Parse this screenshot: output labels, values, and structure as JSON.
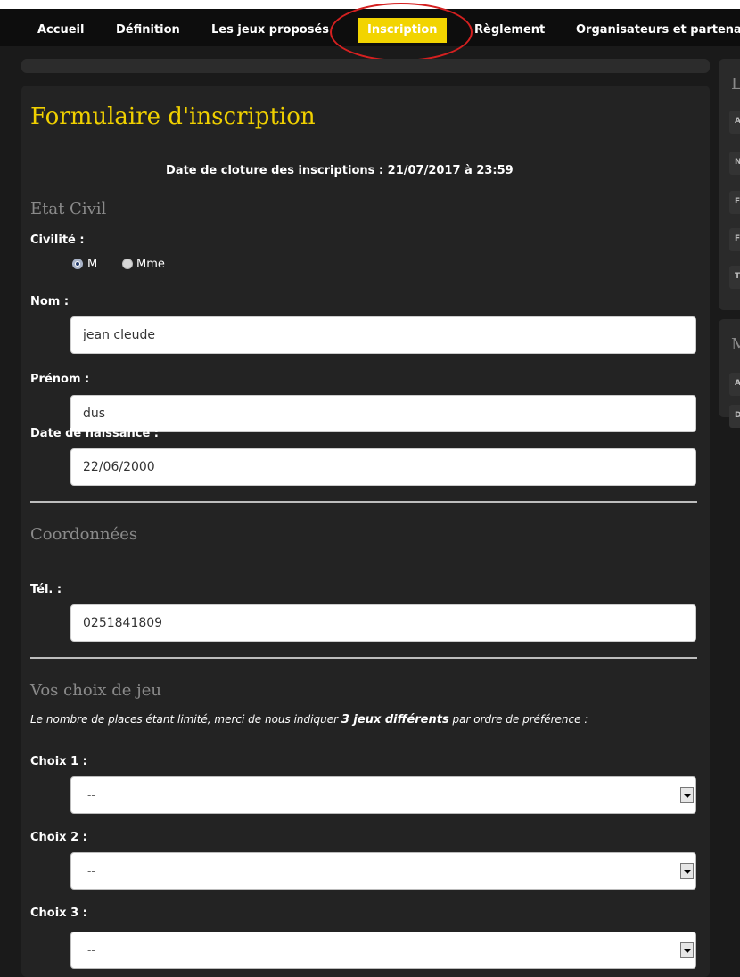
{
  "nav": {
    "items": [
      "Accueil",
      "Définition",
      "Les jeux proposés",
      "Inscription",
      "Règlement",
      "Organisateurs et partenaires"
    ],
    "active": "Inscription",
    "accent": "#f2d400",
    "highlight_color": "#d42020"
  },
  "sidebar": {
    "box1_title": "L",
    "box1_rows": [
      "A",
      "N",
      "F",
      "F",
      "T"
    ],
    "box2_title": "M",
    "box2_rows": [
      "A",
      "D"
    ]
  },
  "form": {
    "title": "Formulaire d'inscription",
    "deadline": "Date de cloture des inscriptions : 21/07/2017 à 23:59",
    "etat_civil": {
      "heading": "Etat Civil",
      "civilite_label": "Civilité :",
      "civilite_options": [
        "M",
        "Mme"
      ],
      "civilite_selected": "M",
      "nom_label": "Nom :",
      "nom_value": "jean cleude",
      "prenom_label": "Prénom :",
      "prenom_value": "dus",
      "naissance_label": "Date de naissance :",
      "naissance_value": "22/06/2000"
    },
    "coordonnees": {
      "heading": "Coordonnées",
      "tel_label": "Tél. :",
      "tel_value": "0251841809"
    },
    "jeux": {
      "heading": "Vos choix de jeu",
      "intro_before": "Le nombre de places étant limité, merci de nous indiquer ",
      "intro_bold": "3 jeux différents",
      "intro_after": " par ordre de préférence :",
      "choices": [
        {
          "label": "Choix 1 :",
          "value": "--"
        },
        {
          "label": "Choix 2 :",
          "value": "--"
        },
        {
          "label": "Choix 3 :",
          "value": "--"
        }
      ]
    }
  }
}
